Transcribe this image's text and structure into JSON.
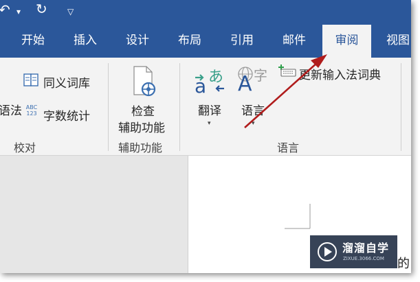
{
  "titlebar": {
    "undo_glyph": "↶",
    "dropdown_glyph": "▾",
    "redo_glyph": "↻",
    "customize_glyph": "▽"
  },
  "tabs": [
    {
      "label": "开始"
    },
    {
      "label": "插入"
    },
    {
      "label": "设计"
    },
    {
      "label": "布局"
    },
    {
      "label": "引用"
    },
    {
      "label": "邮件"
    },
    {
      "label": "审阅",
      "active": true
    },
    {
      "label": "视图"
    }
  ],
  "ribbon": {
    "proofing": {
      "spelling_partial": "语法",
      "thesaurus": "同义词库",
      "word_count": "字数统计",
      "word_count_icon_text": "ABC 123",
      "group_label": "校对"
    },
    "accessibility": {
      "check_line1": "检查",
      "check_line2": "辅助功能",
      "group_label": "辅助功能"
    },
    "language": {
      "translate": "翻译",
      "language": "语言",
      "update_ime": "更新输入法词典",
      "group_label": "语言",
      "translate_icon_a": "a",
      "translate_icon_kana": "あ",
      "language_icon_a": "A",
      "language_icon_zi": "字"
    }
  },
  "document": {
    "visible_char": "的"
  },
  "watermark": {
    "brand": "溜溜自学",
    "url": "ZIXUE.3066.COM"
  },
  "colors": {
    "title_blue": "#2b579a",
    "ribbon_bg": "#f3f3f3",
    "arrow_red": "#b01c1c"
  }
}
